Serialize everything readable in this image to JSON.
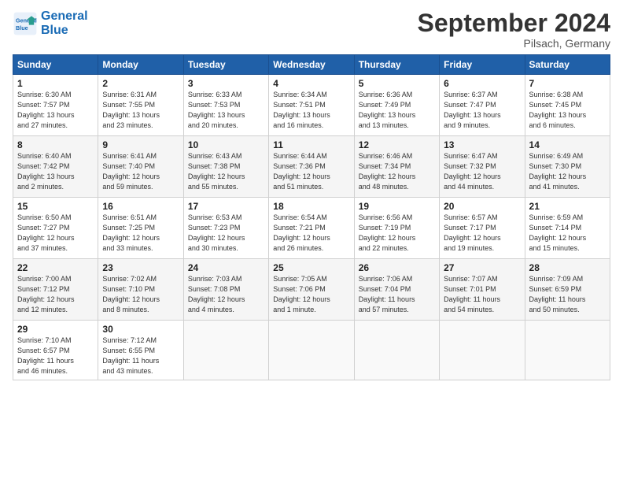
{
  "header": {
    "logo_line1": "General",
    "logo_line2": "Blue",
    "month": "September 2024",
    "location": "Pilsach, Germany"
  },
  "weekdays": [
    "Sunday",
    "Monday",
    "Tuesday",
    "Wednesday",
    "Thursday",
    "Friday",
    "Saturday"
  ],
  "weeks": [
    [
      {
        "day": "1",
        "info": "Sunrise: 6:30 AM\nSunset: 7:57 PM\nDaylight: 13 hours\nand 27 minutes."
      },
      {
        "day": "2",
        "info": "Sunrise: 6:31 AM\nSunset: 7:55 PM\nDaylight: 13 hours\nand 23 minutes."
      },
      {
        "day": "3",
        "info": "Sunrise: 6:33 AM\nSunset: 7:53 PM\nDaylight: 13 hours\nand 20 minutes."
      },
      {
        "day": "4",
        "info": "Sunrise: 6:34 AM\nSunset: 7:51 PM\nDaylight: 13 hours\nand 16 minutes."
      },
      {
        "day": "5",
        "info": "Sunrise: 6:36 AM\nSunset: 7:49 PM\nDaylight: 13 hours\nand 13 minutes."
      },
      {
        "day": "6",
        "info": "Sunrise: 6:37 AM\nSunset: 7:47 PM\nDaylight: 13 hours\nand 9 minutes."
      },
      {
        "day": "7",
        "info": "Sunrise: 6:38 AM\nSunset: 7:45 PM\nDaylight: 13 hours\nand 6 minutes."
      }
    ],
    [
      {
        "day": "8",
        "info": "Sunrise: 6:40 AM\nSunset: 7:42 PM\nDaylight: 13 hours\nand 2 minutes."
      },
      {
        "day": "9",
        "info": "Sunrise: 6:41 AM\nSunset: 7:40 PM\nDaylight: 12 hours\nand 59 minutes."
      },
      {
        "day": "10",
        "info": "Sunrise: 6:43 AM\nSunset: 7:38 PM\nDaylight: 12 hours\nand 55 minutes."
      },
      {
        "day": "11",
        "info": "Sunrise: 6:44 AM\nSunset: 7:36 PM\nDaylight: 12 hours\nand 51 minutes."
      },
      {
        "day": "12",
        "info": "Sunrise: 6:46 AM\nSunset: 7:34 PM\nDaylight: 12 hours\nand 48 minutes."
      },
      {
        "day": "13",
        "info": "Sunrise: 6:47 AM\nSunset: 7:32 PM\nDaylight: 12 hours\nand 44 minutes."
      },
      {
        "day": "14",
        "info": "Sunrise: 6:49 AM\nSunset: 7:30 PM\nDaylight: 12 hours\nand 41 minutes."
      }
    ],
    [
      {
        "day": "15",
        "info": "Sunrise: 6:50 AM\nSunset: 7:27 PM\nDaylight: 12 hours\nand 37 minutes."
      },
      {
        "day": "16",
        "info": "Sunrise: 6:51 AM\nSunset: 7:25 PM\nDaylight: 12 hours\nand 33 minutes."
      },
      {
        "day": "17",
        "info": "Sunrise: 6:53 AM\nSunset: 7:23 PM\nDaylight: 12 hours\nand 30 minutes."
      },
      {
        "day": "18",
        "info": "Sunrise: 6:54 AM\nSunset: 7:21 PM\nDaylight: 12 hours\nand 26 minutes."
      },
      {
        "day": "19",
        "info": "Sunrise: 6:56 AM\nSunset: 7:19 PM\nDaylight: 12 hours\nand 22 minutes."
      },
      {
        "day": "20",
        "info": "Sunrise: 6:57 AM\nSunset: 7:17 PM\nDaylight: 12 hours\nand 19 minutes."
      },
      {
        "day": "21",
        "info": "Sunrise: 6:59 AM\nSunset: 7:14 PM\nDaylight: 12 hours\nand 15 minutes."
      }
    ],
    [
      {
        "day": "22",
        "info": "Sunrise: 7:00 AM\nSunset: 7:12 PM\nDaylight: 12 hours\nand 12 minutes."
      },
      {
        "day": "23",
        "info": "Sunrise: 7:02 AM\nSunset: 7:10 PM\nDaylight: 12 hours\nand 8 minutes."
      },
      {
        "day": "24",
        "info": "Sunrise: 7:03 AM\nSunset: 7:08 PM\nDaylight: 12 hours\nand 4 minutes."
      },
      {
        "day": "25",
        "info": "Sunrise: 7:05 AM\nSunset: 7:06 PM\nDaylight: 12 hours\nand 1 minute."
      },
      {
        "day": "26",
        "info": "Sunrise: 7:06 AM\nSunset: 7:04 PM\nDaylight: 11 hours\nand 57 minutes."
      },
      {
        "day": "27",
        "info": "Sunrise: 7:07 AM\nSunset: 7:01 PM\nDaylight: 11 hours\nand 54 minutes."
      },
      {
        "day": "28",
        "info": "Sunrise: 7:09 AM\nSunset: 6:59 PM\nDaylight: 11 hours\nand 50 minutes."
      }
    ],
    [
      {
        "day": "29",
        "info": "Sunrise: 7:10 AM\nSunset: 6:57 PM\nDaylight: 11 hours\nand 46 minutes."
      },
      {
        "day": "30",
        "info": "Sunrise: 7:12 AM\nSunset: 6:55 PM\nDaylight: 11 hours\nand 43 minutes."
      },
      {
        "day": "",
        "info": ""
      },
      {
        "day": "",
        "info": ""
      },
      {
        "day": "",
        "info": ""
      },
      {
        "day": "",
        "info": ""
      },
      {
        "day": "",
        "info": ""
      }
    ]
  ]
}
